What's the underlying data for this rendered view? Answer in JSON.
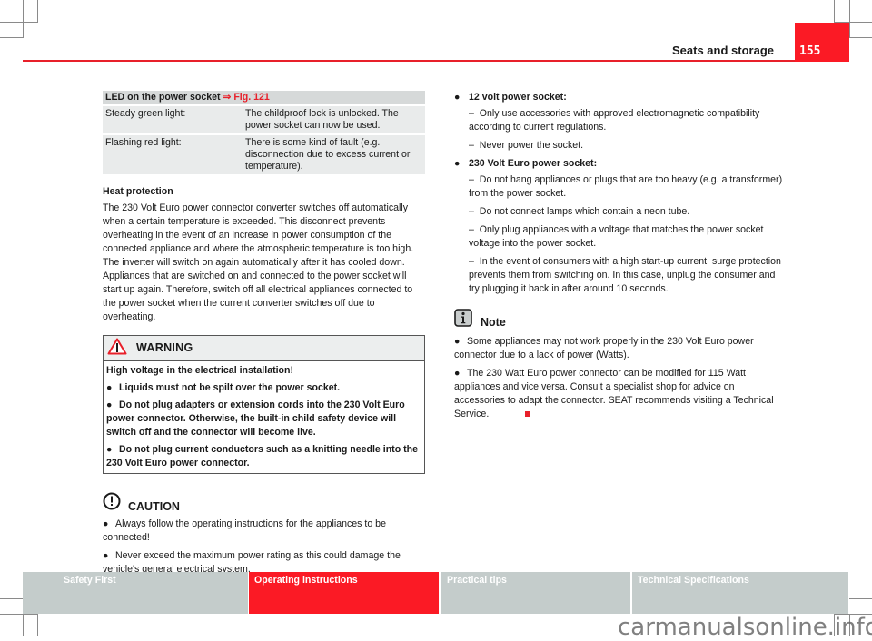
{
  "header": {
    "section_title": "Seats and storage",
    "page_number": "155",
    "accent_color": "#fb1a25"
  },
  "led_table": {
    "title": "LED on the power socket",
    "xref": "⇒ Fig. 121",
    "rows": [
      {
        "label": "Steady green light:",
        "text": "The childproof lock is unlocked. The power socket can now be used."
      },
      {
        "label": "Flashing red light:",
        "text": "There is some kind of fault (e.g. disconnection due to excess current or temperature)."
      }
    ]
  },
  "heat": {
    "heading": "Heat protection",
    "body": "The 230 Volt Euro power connector converter switches off automatically when a certain temperature is exceeded. This disconnect prevents overheating in the event of an increase in power consumption of the connected appliance and where the atmospheric temperature is too high. The inverter will switch on again automatically after it has cooled down. Appliances that are switched on and connected to the power socket will start up again. Therefore, switch off all electrical appliances connected to the power socket when the current converter switches off due to overheating."
  },
  "warning": {
    "icon": "warning-triangle-icon",
    "title": "WARNING",
    "lead": "High voltage in the electrical installation!",
    "items": [
      "Liquids must not be spilt over the power socket.",
      "Do not plug adapters or extension cords into the 230 Volt Euro power connector. Otherwise, the built-in child safety device will switch off and the connector will become live.",
      "Do not plug current conductors such as a knitting needle into the 230 Volt Euro power connector."
    ]
  },
  "caution": {
    "icon": "caution-exclamation-icon",
    "title": "CAUTION",
    "items": [
      "Always follow the operating instructions for the appliances to be connected!",
      "Never exceed the maximum power rating as this could damage the vehicle's general electrical system."
    ]
  },
  "sockets": [
    {
      "title": "12 volt power socket:",
      "items": [
        "Only use accessories with approved electromagnetic compatibility according to current regulations.",
        "Never power the socket."
      ]
    },
    {
      "title": "230 Volt Euro power socket:",
      "items": [
        "Do not hang appliances or plugs that are too heavy (e.g. a transformer) from the power socket.",
        "Do not connect lamps which contain a neon tube.",
        "Only plug appliances with a voltage that matches the power socket voltage into the power socket.",
        "In the event of consumers with a high start-up current, surge protection prevents them from switching on. In this case, unplug the consumer and try plugging it back in after around 10 seconds."
      ]
    }
  ],
  "note": {
    "icon": "info-icon",
    "title": "Note",
    "items": [
      "Some appliances may not work properly in the 230 Volt Euro power connector due to a lack of power (Watts).",
      "The 230 Watt Euro power connector can be modified for 115 Watt appliances and vice versa. Consult a specialist shop for advice on accessories to adapt the connector. SEAT recommends visiting a Technical Service."
    ]
  },
  "footer_tabs": [
    {
      "label": "Safety First",
      "active": false
    },
    {
      "label": "Operating instructions",
      "active": true
    },
    {
      "label": "Practical tips",
      "active": false
    },
    {
      "label": "Technical Specifications",
      "active": false
    }
  ],
  "watermark": "carmanualsonline.info",
  "glyphs": {
    "bullet": "●",
    "dash": "–"
  }
}
